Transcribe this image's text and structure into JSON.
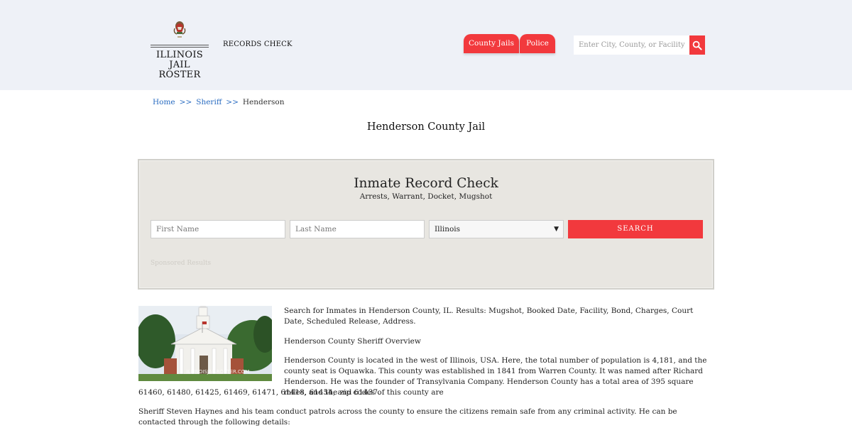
{
  "header": {
    "logo_line1": "ILLINOIS",
    "logo_line2": "JAIL ROSTER",
    "records_check": "RECORDS CHECK",
    "nav": [
      {
        "label": "County Jails"
      },
      {
        "label": "Police"
      }
    ],
    "search_placeholder": "Enter City, County, or Facility",
    "accent_color": "#f2393d"
  },
  "breadcrumb": {
    "home": "Home",
    "sheriff": "Sheriff",
    "current": "Henderson",
    "separator": ">>"
  },
  "page_title": "Henderson County Jail",
  "record_check": {
    "title": "Inmate Record Check",
    "subtitle": "Arrests, Warrant, Docket, Mugshot",
    "first_name_placeholder": "First Name",
    "last_name_placeholder": "Last Name",
    "state_selected": "Illinois",
    "search_label": "SEARCH",
    "sponsored": "Sponsored Results"
  },
  "content": {
    "photo_watermark": "ILLINOISJAILROSTER.COM",
    "intro": "Search for Inmates in Henderson County, IL. Results: Mugshot, Booked Date, Facility, Bond, Charges, Court Date, Scheduled Release, Address.",
    "overview_heading": "Henderson County Sheriff Overview",
    "overview_part1": "Henderson County is located in the west of Illinois, USA. Here, the total number of population is 4,181, and the county seat is Oquawka. This county was established in 1841 from Warren County. It was named after Richard Henderson. He was the founder of Transylvania Company. Henderson County has a total area of 395 square miles, and the zip codes of this county are",
    "overview_part2": "61460, 61480, 61425, 61469, 61471, 61418, 61454, and 61437.",
    "sheriff_text": "Sheriff Steven Haynes and his team conduct patrols across the county to ensure the citizens remain safe from any criminal activity. He can be contacted through the following details:"
  }
}
